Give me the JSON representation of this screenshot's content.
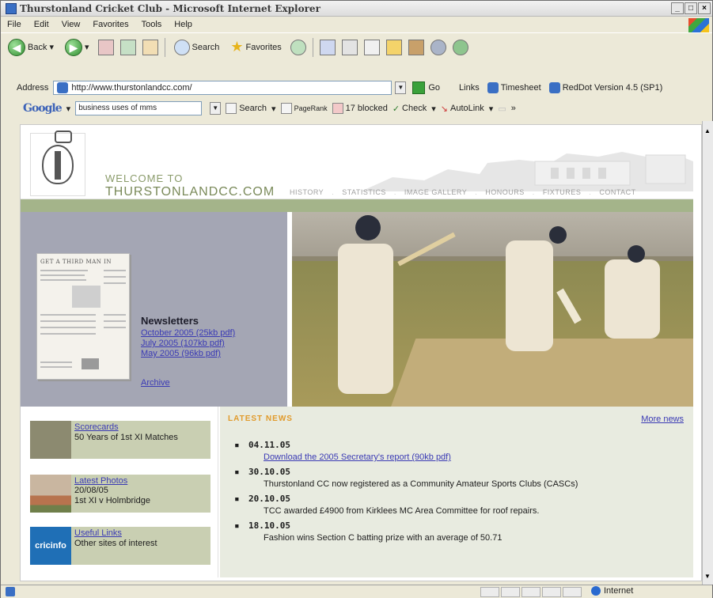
{
  "window": {
    "title": "Thurstonland Cricket Club - Microsoft Internet Explorer",
    "buttons": [
      "_",
      "□",
      "×"
    ]
  },
  "menu": [
    "File",
    "Edit",
    "View",
    "Favorites",
    "Tools",
    "Help"
  ],
  "toolbar": {
    "back": "Back",
    "search": "Search",
    "favorites": "Favorites"
  },
  "address": {
    "label": "Address",
    "url": "http://www.thurstonlandcc.com/",
    "go": "Go",
    "links_label": "Links",
    "link1": "Timesheet",
    "link2": "RedDot Version 4.5 (SP1)"
  },
  "google": {
    "logo": "Google",
    "query": "business uses of mms",
    "search": "Search",
    "pagerank": "PageRank",
    "blocked": "17 blocked",
    "check": "Check",
    "autolink": "AutoLink"
  },
  "site": {
    "welcome_line1": "WELCOME TO",
    "welcome_line2": "THURSTONLANDCC.COM",
    "nav": [
      "HISTORY",
      "STATISTICS",
      "IMAGE GALLERY",
      "HONOURS",
      "FIXTURES",
      "CONTACT"
    ],
    "newsletter_cover_title": "GET A THIRD MAN IN",
    "newsletters_title": "Newsletters",
    "newsletters": [
      "October 2005 (25kb pdf)",
      "July 2005 (107kb pdf)",
      "May 2005 (96kb pdf)"
    ],
    "archive": "Archive",
    "tiles": [
      {
        "link": "Scorecards",
        "sub": [
          "50 Years of 1st XI Matches"
        ]
      },
      {
        "link": "Latest Photos",
        "sub": [
          "20/08/05",
          "1st XI v Holmbridge"
        ]
      },
      {
        "link": "Useful Links",
        "sub": [
          "Other sites of interest"
        ],
        "thumb_text": "cricinfo"
      }
    ],
    "latest_news_title": "LATEST NEWS",
    "more_news": "More news",
    "news": [
      {
        "date": "04.11.05",
        "text": "Download the 2005 Secretary's report (90kb pdf)",
        "is_link": true
      },
      {
        "date": "30.10.05",
        "text": "Thurstonland CC now registered as a Community Amateur Sports Clubs (CASCs)",
        "is_link": false
      },
      {
        "date": "20.10.05",
        "text": "TCC awarded £4900 from Kirklees MC Area Committee for roof repairs.",
        "is_link": false
      },
      {
        "date": "18.10.05",
        "text": "Fashion wins Section C batting prize with an average of 50.71",
        "is_link": false
      }
    ]
  },
  "status": {
    "zone": "Internet"
  },
  "colors": {
    "accent_green": "#a4b48a",
    "news_orange": "#e19a2b",
    "link_blue": "#3a3ab4",
    "panel_lavender": "#a4a6b4"
  }
}
